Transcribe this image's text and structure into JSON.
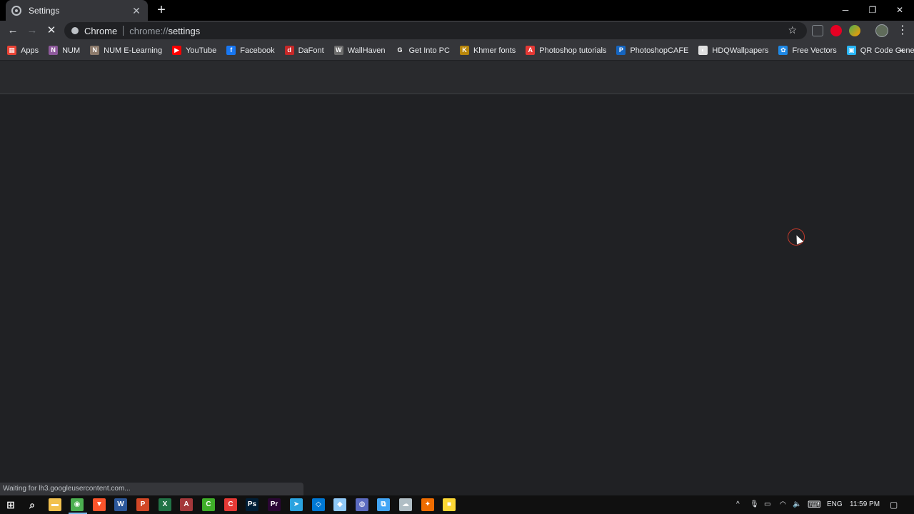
{
  "tab": {
    "title": "Settings",
    "close": "✕",
    "new_tab": "+"
  },
  "window": {
    "minimize": "─",
    "restore": "❐",
    "close": "✕"
  },
  "toolbar": {
    "back": "←",
    "forward": "→",
    "stop": "✕",
    "omnibox_label": "Chrome",
    "url_scheme": "chrome://",
    "url_path": "settings",
    "star": "☆",
    "menu": "⋮"
  },
  "bookmarks": [
    {
      "label": "Apps",
      "icon": "apps-grid-icon",
      "color": "#ea4335",
      "glyph": "▦"
    },
    {
      "label": "NUM",
      "icon": "num-icon",
      "color": "#8e5a9c",
      "glyph": "N"
    },
    {
      "label": "NUM E-Learning",
      "icon": "num-elearning-icon",
      "color": "#8c7a6b",
      "glyph": "N"
    },
    {
      "label": "YouTube",
      "icon": "youtube-icon",
      "color": "#ff0000",
      "glyph": "▶"
    },
    {
      "label": "Facebook",
      "icon": "facebook-icon",
      "color": "#1877f2",
      "glyph": "f"
    },
    {
      "label": "DaFont",
      "icon": "dafont-icon",
      "color": "#c62828",
      "glyph": "d"
    },
    {
      "label": "WallHaven",
      "icon": "wallhaven-icon",
      "color": "#6d6d6d",
      "glyph": "W"
    },
    {
      "label": "Get Into PC",
      "icon": "google-icon",
      "color": "#35363a",
      "glyph": "G"
    },
    {
      "label": "Khmer fonts",
      "icon": "khmer-fonts-icon",
      "color": "#b8860b",
      "glyph": "K"
    },
    {
      "label": "Photoshop tutorials",
      "icon": "adobe-icon",
      "color": "#e53935",
      "glyph": "A"
    },
    {
      "label": "PhotoshopCAFE",
      "icon": "photoshopcafe-icon",
      "color": "#1565c0",
      "glyph": "P"
    },
    {
      "label": "HDQWallpapers",
      "icon": "hdq-icon",
      "color": "#e0e0e0",
      "glyph": "◐"
    },
    {
      "label": "Free Vectors",
      "icon": "free-vectors-icon",
      "color": "#1e88e5",
      "glyph": "✿"
    },
    {
      "label": "QR Code Generator",
      "icon": "qr-code-icon",
      "color": "#29b6f6",
      "glyph": "▣"
    }
  ],
  "bookmarks_more": "»",
  "status_text": "Waiting for lh3.googleusercontent.com...",
  "taskbar": {
    "start": "⊞",
    "search": "⌕",
    "apps": [
      {
        "name": "file-explorer-icon",
        "color": "#f2c14e",
        "glyph": "▬"
      },
      {
        "name": "chrome-icon",
        "color": "#4caf50",
        "glyph": "◉"
      },
      {
        "name": "brave-icon",
        "color": "#fb542b",
        "glyph": "▼"
      },
      {
        "name": "word-icon",
        "color": "#2b579a",
        "glyph": "W"
      },
      {
        "name": "powerpoint-icon",
        "color": "#d24726",
        "glyph": "P"
      },
      {
        "name": "excel-icon",
        "color": "#217346",
        "glyph": "X"
      },
      {
        "name": "access-icon",
        "color": "#a4373a",
        "glyph": "A"
      },
      {
        "name": "camtasia-green-icon",
        "color": "#3fae29",
        "glyph": "C"
      },
      {
        "name": "camtasia-red-icon",
        "color": "#e53935",
        "glyph": "C"
      },
      {
        "name": "photoshop-icon",
        "color": "#001e36",
        "glyph": "Ps"
      },
      {
        "name": "premiere-icon",
        "color": "#2a0634",
        "glyph": "Pr"
      },
      {
        "name": "telegram-icon",
        "color": "#2aa3df",
        "glyph": "➤"
      },
      {
        "name": "vscode-icon",
        "color": "#0078d4",
        "glyph": "◇"
      },
      {
        "name": "3d-box-icon",
        "color": "#90caf9",
        "glyph": "◆"
      },
      {
        "name": "globe-app-icon",
        "color": "#5c6bc0",
        "glyph": "◍"
      },
      {
        "name": "snip-icon",
        "color": "#42a5f5",
        "glyph": "⧉"
      },
      {
        "name": "cloud-app-icon",
        "color": "#b0bec5",
        "glyph": "☁"
      },
      {
        "name": "git-app-icon",
        "color": "#ef6c00",
        "glyph": "✦"
      },
      {
        "name": "sticky-notes-icon",
        "color": "#fdd835",
        "glyph": "■"
      }
    ],
    "tray": {
      "chevron": "^",
      "mic": "🎙",
      "battery": "▭",
      "wifi": "◠",
      "volume": "🔈",
      "keyboard": "⌨",
      "language": "ENG",
      "time": "11:59 PM",
      "notifications": "▢"
    }
  }
}
